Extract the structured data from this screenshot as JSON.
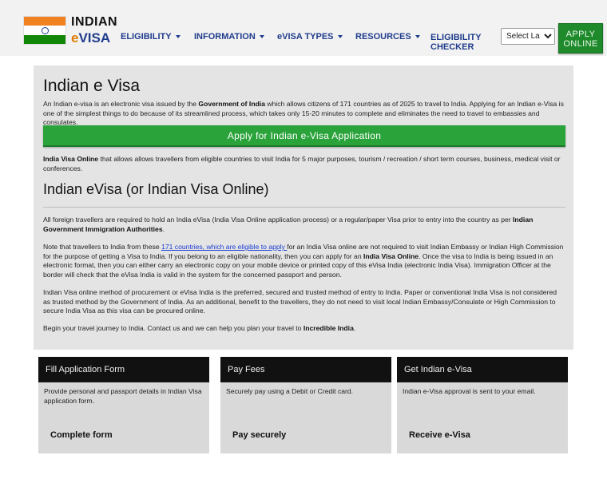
{
  "header": {
    "logo_line1": "INDIAN",
    "logo_line2_e": "e",
    "logo_line2_rest": "VISA",
    "nav": [
      {
        "label": "ELIGIBILITY",
        "dropdown": true
      },
      {
        "label": "INFORMATION",
        "dropdown": true
      },
      {
        "label": "eVISA TYPES",
        "dropdown": true
      },
      {
        "label": "RESOURCES",
        "dropdown": true
      },
      {
        "label_line1": "ELIGIBILITY",
        "label_line2": "CHECKER",
        "dropdown": false
      }
    ],
    "language_select": "Select Language",
    "apply_line1": "APPLY",
    "apply_line2": "ONLINE",
    "colors": {
      "nav_text": "#1f3c8c",
      "apply_bg": "#1e8a2c"
    }
  },
  "main": {
    "title": "Indian e Visa",
    "intro": {
      "t1": "An Indian e-visa is an electronic visa issued by the ",
      "b1": "Government of India",
      "t2": " which allows citizens of 171 countries as of 2025 to travel to India. Applying for an Indian e-Visa is one of the simplest things to do because of its streamlined process, which takes only 15-20 minutes to complete and eliminates the need to travel to embassies and consulates."
    },
    "cta_label": "Apply for Indian e-Visa Application",
    "purposes": {
      "b1": "India Visa Online",
      "t1": " that allows allows travellers from eligible countries to visit India for 5 major purposes, tourism / recreation / short term courses, business, medical visit or conferences."
    },
    "subtitle": "Indian eVisa (or Indian Visa Online)",
    "para1": {
      "t1": "All foreign travellers are required to hold an India eVisa (India Visa Online application process) or a regular/paper Visa prior to entry into the country as per ",
      "b1": "Indian Government Immigration Authorities",
      "t2": "."
    },
    "para2": {
      "t1": "Note that travellers to India from these ",
      "link": "171 countries, which are eligible to apply ",
      "t2": "for an India Visa online are not required to visit Indian Embassy or Indian High Commission for the purpose of getting a Visa to India. If you belong to an eligible nationality, then you can apply for an ",
      "b1": "India Visa Online",
      "t3": ". Once the visa to India is being issued in an electronic format, then you can either carry an electronic copy on your mobile device or printed copy of this eVisa India (electronic India Visa). Immigration Officer at the border will check that the eVisa India is valid in the system for the concerned passport and person."
    },
    "para3": "Indian Visa online method of procurement or eVisa India is the preferred, secured and trusted method of entry to India. Paper or conventional India Visa is not considered as trusted method by the Government of India. As an additional, benefit to the travellers, they do not need to visit local Indian Embassy/Consulate or High Commission to secure India Visa as this visa can be procured online.",
    "para4": {
      "t1": "Begin your travel journey to India. Contact us and we can help you plan your travel to ",
      "b1": "Incredible India",
      "t2": "."
    }
  },
  "cards": [
    {
      "title": "Fill Application Form",
      "body": "Provide personal and passport details in Indian Visa application form.",
      "footer": "Complete form"
    },
    {
      "title": "Pay Fees",
      "body": "Securely pay using a Debit or Credit card.",
      "footer": "Pay securely"
    },
    {
      "title": "Get Indian e-Visa",
      "body": "Indian e-Visa approval is sent to your email.",
      "footer": "Receive e-Visa"
    }
  ]
}
